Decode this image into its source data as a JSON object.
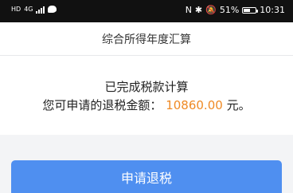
{
  "status_bar": {
    "left": {
      "hd": "HD",
      "network": "4G"
    },
    "right": {
      "nfc": "N",
      "battery_percent": "51%",
      "time": "10:31"
    }
  },
  "header": {
    "title": "综合所得年度汇算"
  },
  "summary": {
    "line1": "已完成税款计算",
    "line2_prefix": "您可申请的退税金额：",
    "amount": "10860.00",
    "amount_suffix": "元。"
  },
  "actions": {
    "apply_label": "申请退税"
  },
  "colors": {
    "accent_orange": "#ef8a25",
    "button_blue": "#4f8ff0"
  }
}
